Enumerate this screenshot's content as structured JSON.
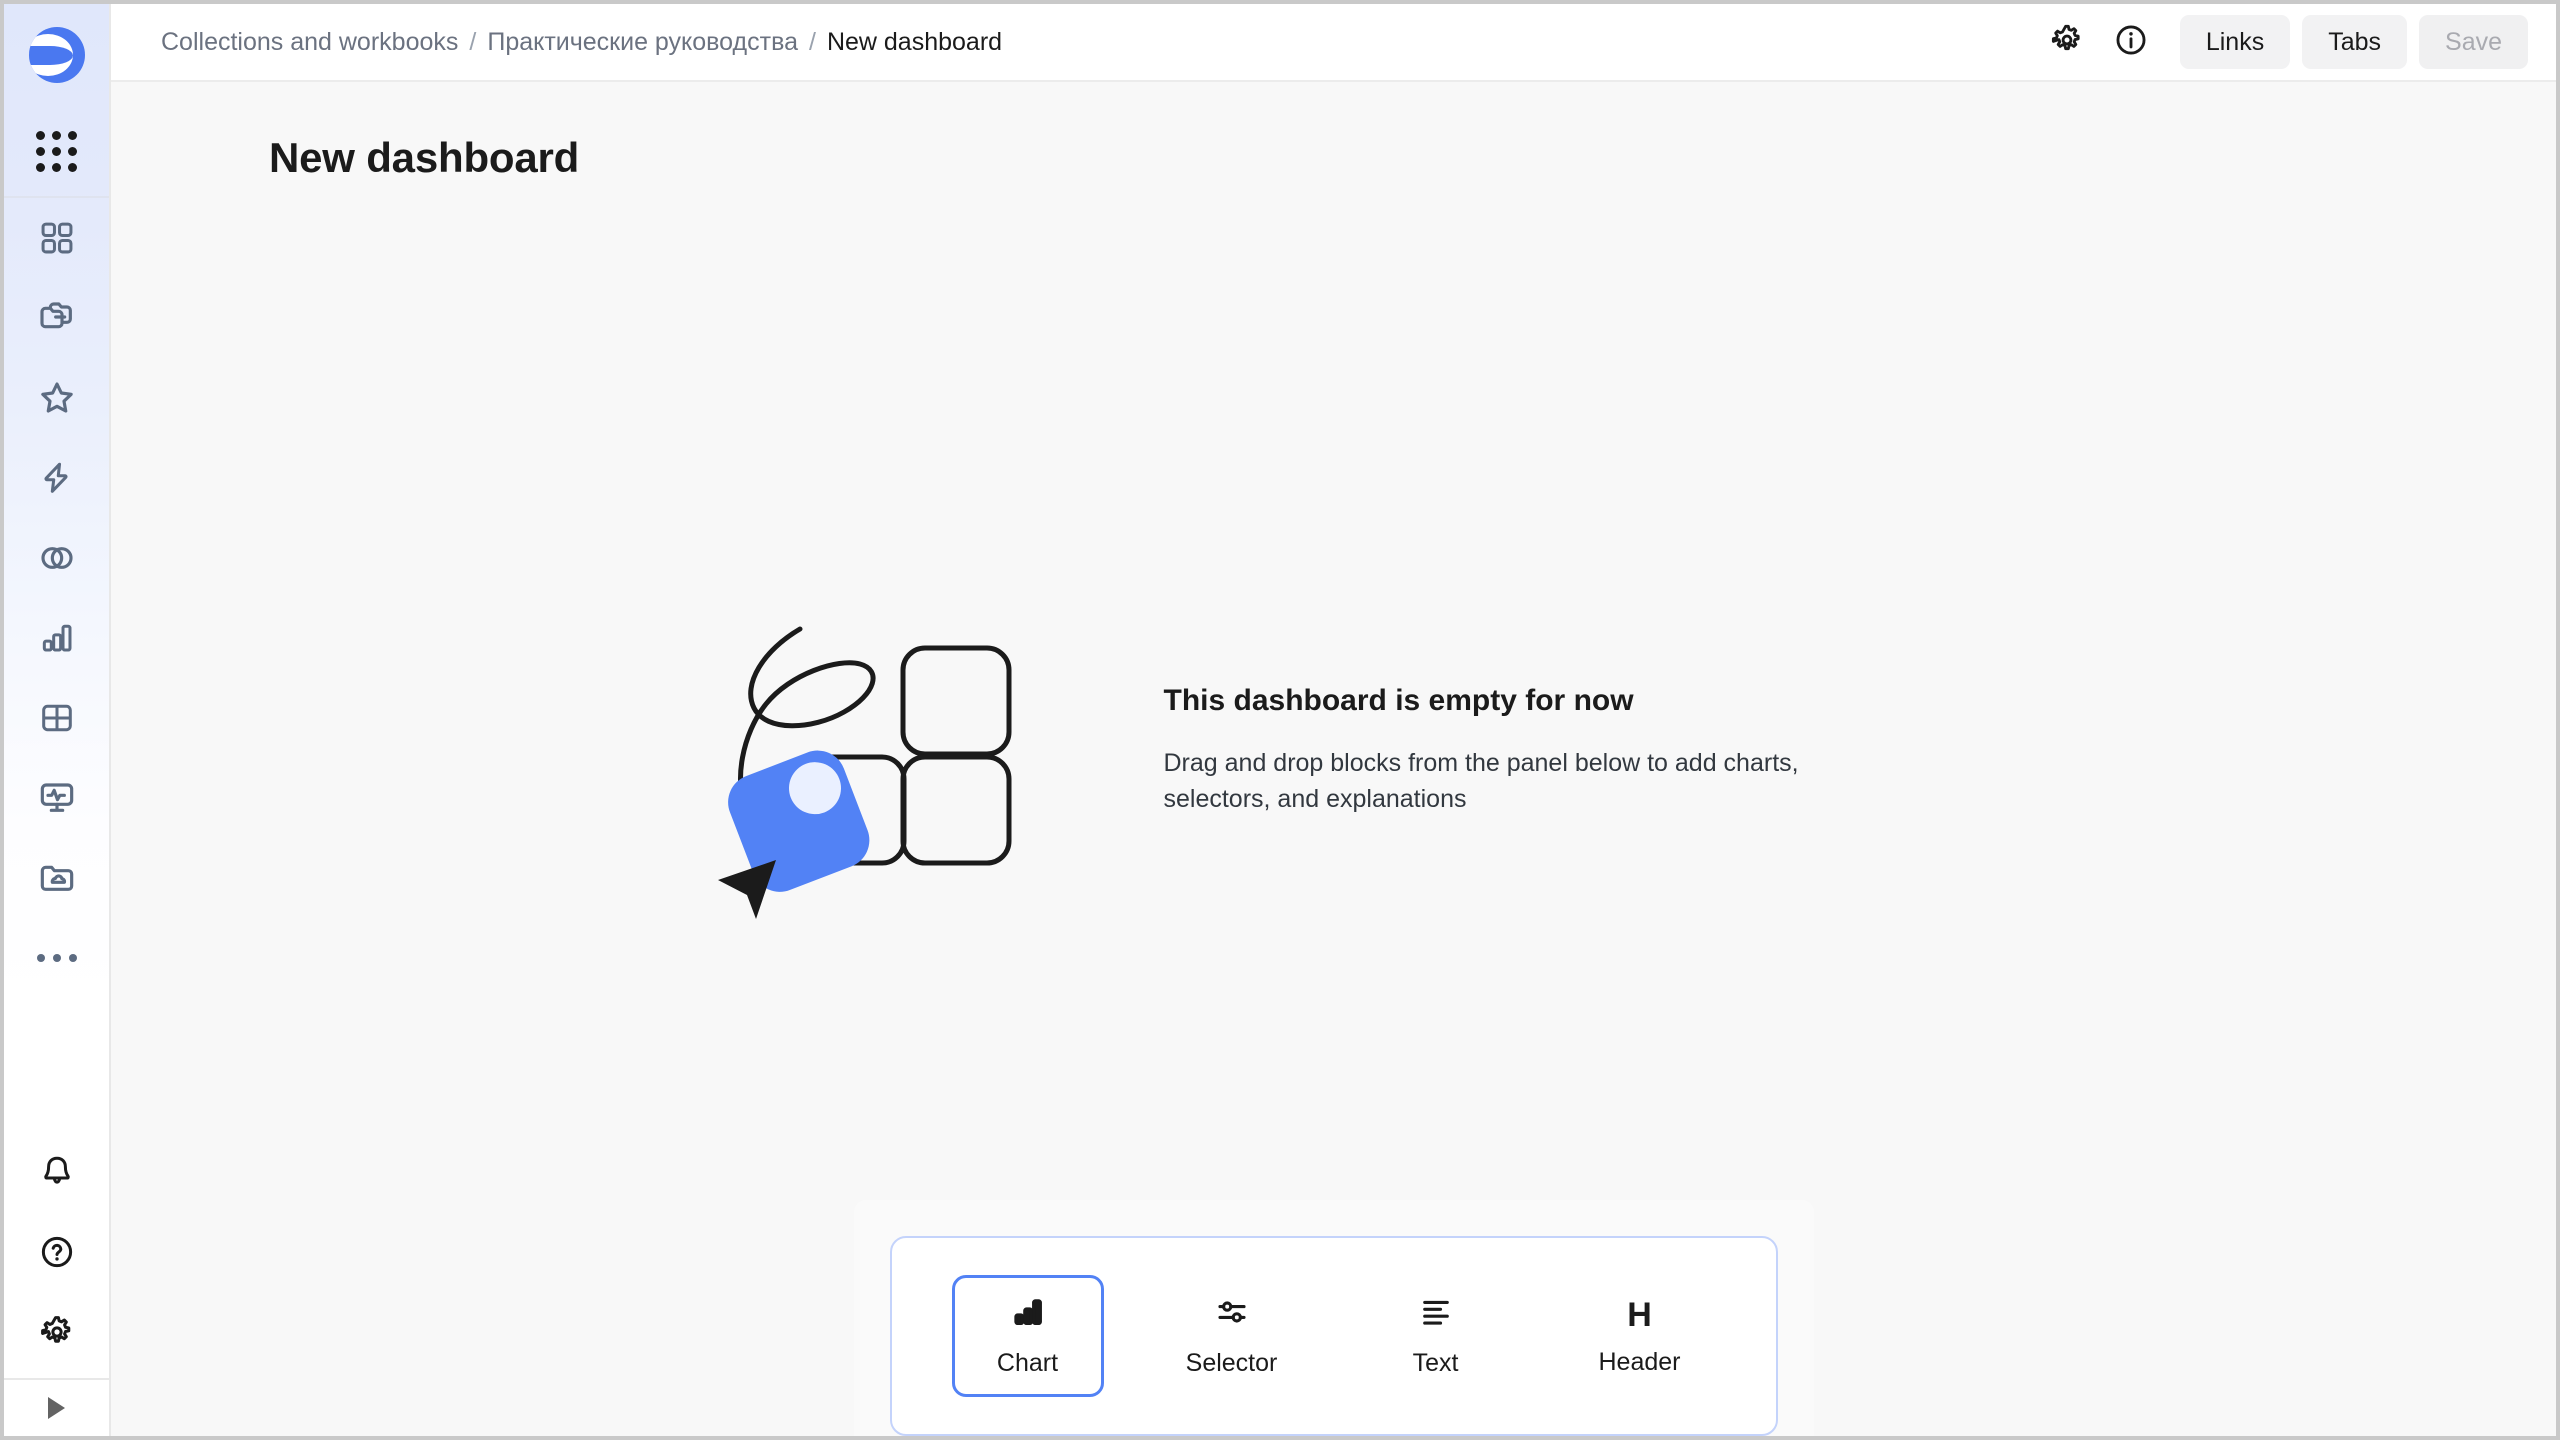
{
  "app": {
    "logo_icon": "datalens-logo-icon",
    "apps_icon": "apps-grid-icon"
  },
  "sidebar": {
    "nav_items": [
      {
        "icon": "dashboards-grid-icon",
        "name": "sidebar-item-dashboards"
      },
      {
        "icon": "folders-icon",
        "name": "sidebar-item-collections"
      },
      {
        "icon": "star-icon",
        "name": "sidebar-item-favorites"
      },
      {
        "icon": "lightning-icon",
        "name": "sidebar-item-connections"
      },
      {
        "icon": "venn-circles-icon",
        "name": "sidebar-item-datasets"
      },
      {
        "icon": "bar-chart-icon",
        "name": "sidebar-item-charts"
      },
      {
        "icon": "table-grid-icon",
        "name": "sidebar-item-tables"
      },
      {
        "icon": "monitor-pulse-icon",
        "name": "sidebar-item-monitoring"
      },
      {
        "icon": "folder-cloud-icon",
        "name": "sidebar-item-storage"
      },
      {
        "icon": "ellipsis-icon",
        "name": "sidebar-item-more"
      }
    ],
    "bottom_items": [
      {
        "icon": "bell-icon",
        "name": "sidebar-item-notifications"
      },
      {
        "icon": "question-circle-icon",
        "name": "sidebar-item-help"
      },
      {
        "icon": "gear-icon",
        "name": "sidebar-item-settings"
      }
    ],
    "collapse_icon": "expand-arrow-icon"
  },
  "topbar": {
    "breadcrumbs": [
      {
        "label": "Collections and workbooks",
        "current": false
      },
      {
        "label": "Практические руководства",
        "current": false
      },
      {
        "label": "New dashboard",
        "current": true
      }
    ],
    "separator": "/",
    "gear_icon": "gear-icon",
    "info_icon": "info-circle-icon",
    "links_label": "Links",
    "tabs_label": "Tabs",
    "save_label": "Save",
    "save_disabled": true
  },
  "page": {
    "title": "New dashboard"
  },
  "empty_state": {
    "title": "This dashboard is empty for now",
    "description": "Drag and drop blocks from the panel below to add charts, selectors, and explanations",
    "illustration": "empty-dashboard-illustration"
  },
  "dock": {
    "items": [
      {
        "label": "Chart",
        "icon": "bar-chart-icon",
        "selected": true
      },
      {
        "label": "Selector",
        "icon": "sliders-icon",
        "selected": false
      },
      {
        "label": "Text",
        "icon": "text-align-left-icon",
        "selected": false
      },
      {
        "label": "Header",
        "icon": "heading-h-icon",
        "selected": false
      }
    ]
  },
  "colors": {
    "accent_blue": "#5282f5",
    "logo_blue": "#4a78f0",
    "sidebar_tint": "#e3e9fb",
    "canvas_bg": "#f8f8f8",
    "icon_slate": "#5c6b81",
    "text_primary": "#1b1b1b",
    "text_muted": "#6b7280",
    "dock_border": "#c4d3fb"
  }
}
